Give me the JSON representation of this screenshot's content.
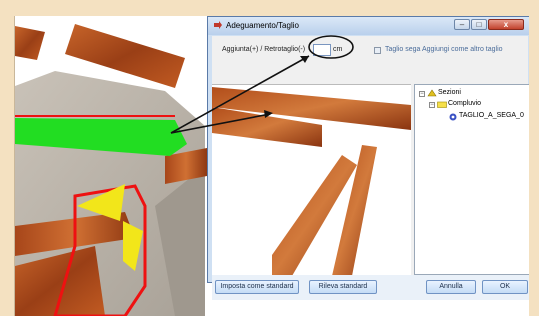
{
  "dialog": {
    "title": "Adeguamento/Taglio",
    "window_buttons": {
      "minimize": "–",
      "maximize": "□",
      "close": "x"
    }
  },
  "form": {
    "offset_label": "Aggiunta(+) / Retrotaglio(-)",
    "offset_value": "",
    "unit": "cm",
    "saw_cut_label": "Taglio sega Aggiungi come altro taglio",
    "saw_cut_checked": false
  },
  "tree": {
    "root": "Sezioni",
    "child": "Compluvio",
    "leaf": "TAGLIO_A_SEGA_0"
  },
  "buttons": {
    "set_standard": "Imposta come standard",
    "detect_standard": "Rileva standard",
    "cancel": "Annulla",
    "ok": "OK"
  },
  "colors": {
    "highlight_green": "#22dd22",
    "marker_red": "#ee1111",
    "marker_yellow": "#f2e61a",
    "wood": "#b5521d"
  }
}
